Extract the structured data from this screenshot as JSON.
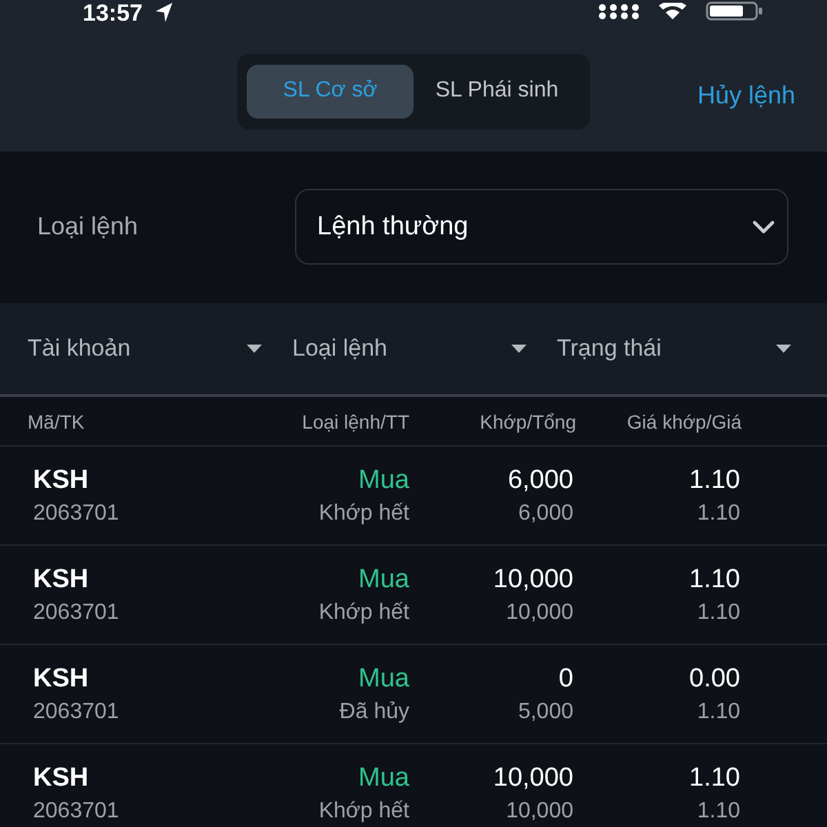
{
  "status_bar": {
    "time": "13:57"
  },
  "header": {
    "tabs": [
      {
        "label": "SL Cơ sở",
        "selected": true
      },
      {
        "label": "SL Phái sinh",
        "selected": false
      }
    ],
    "action": "Hủy lệnh"
  },
  "order_type": {
    "label": "Loại lệnh",
    "value": "Lệnh thường"
  },
  "filters": [
    {
      "label": "Tài khoản"
    },
    {
      "label": "Loại lệnh"
    },
    {
      "label": "Trạng thái"
    }
  ],
  "table": {
    "columns": [
      "Mã/TK",
      "Loại lệnh/TT",
      "Khớp/Tổng",
      "Giá khớp/Giá"
    ],
    "rows": [
      {
        "symbol": "KSH",
        "account": "2063701",
        "side": "Mua",
        "status": "Khớp hết",
        "matched": "6,000",
        "total": "6,000",
        "match_price": "1.10",
        "price": "1.10"
      },
      {
        "symbol": "KSH",
        "account": "2063701",
        "side": "Mua",
        "status": "Khớp hết",
        "matched": "10,000",
        "total": "10,000",
        "match_price": "1.10",
        "price": "1.10"
      },
      {
        "symbol": "KSH",
        "account": "2063701",
        "side": "Mua",
        "status": "Đã hủy",
        "matched": "0",
        "total": "5,000",
        "match_price": "0.00",
        "price": "1.10"
      },
      {
        "symbol": "KSH",
        "account": "2063701",
        "side": "Mua",
        "status": "Khớp hết",
        "matched": "10,000",
        "total": "10,000",
        "match_price": "1.10",
        "price": "1.10"
      }
    ]
  }
}
